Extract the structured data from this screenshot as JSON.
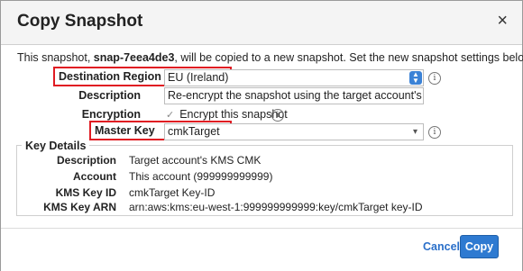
{
  "dialog": {
    "title": "Copy Snapshot",
    "close_symbol": "×"
  },
  "intro": {
    "prefix": "This snapshot, ",
    "snapshot_id": "snap-7eea4de3",
    "suffix": ", will be copied to a new snapshot. Set the new snapshot settings below:"
  },
  "form": {
    "destination_region": {
      "label": "Destination Region",
      "value": "EU (Ireland)"
    },
    "description": {
      "label": "Description",
      "value": "Re-encrypt the snapshot using the target account's KMS CMK"
    },
    "encryption": {
      "label": "Encryption",
      "checkbox_label": "Encrypt this snapshot",
      "checked": true
    },
    "master_key": {
      "label": "Master Key",
      "value": "cmkTarget"
    }
  },
  "key_details": {
    "legend": "Key Details",
    "rows": [
      {
        "label": "Description",
        "value": "Target account's KMS CMK"
      },
      {
        "label": "Account",
        "value": "This account (999999999999)"
      },
      {
        "label": "KMS Key ID",
        "value": "cmkTarget Key-ID"
      },
      {
        "label": "KMS Key ARN",
        "value": "arn:aws:kms:eu-west-1:999999999999:key/cmkTarget key-ID"
      }
    ]
  },
  "footer": {
    "cancel_label": "Cancel",
    "copy_label": "Copy"
  },
  "colors": {
    "accent": "#2e7ad1",
    "highlight_box": "#e01b22"
  },
  "icons": {
    "info": "info-icon",
    "close": "close-icon",
    "check": "check-icon",
    "select": "chevron-updown-icon",
    "dropdown": "chevron-down-icon"
  }
}
